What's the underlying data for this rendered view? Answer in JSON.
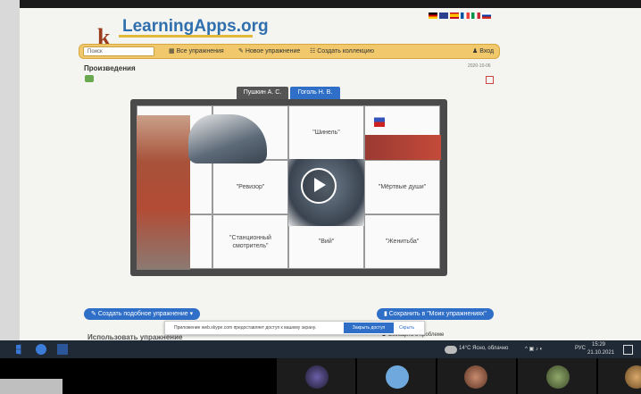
{
  "app": {
    "logo_letter": "k",
    "logo_text": "LearningApps.org"
  },
  "header": {
    "search_placeholder": "Поиск",
    "login_label": "Вход"
  },
  "nav": {
    "all_exercises": "Все упражнения",
    "new_exercise": "Новое упражнение",
    "create_collection": "Создать коллекцию"
  },
  "page": {
    "title": "Произведения",
    "date": "2020-10-06"
  },
  "tabs": [
    {
      "label": "Пушкин А. С."
    },
    {
      "label": "Гоголь Н. В."
    }
  ],
  "cells": [
    {
      "label": ""
    },
    {
      "label": ""
    },
    {
      "label": "\"Шинель\""
    },
    {
      "label": ""
    },
    {
      "label": ""
    },
    {
      "label": "\"Ревизор\""
    },
    {
      "label": ""
    },
    {
      "label": "\"Мёртвые души\""
    },
    {
      "label": ""
    },
    {
      "label": "\"Станционный смотритель\""
    },
    {
      "label": "\"Вий\""
    },
    {
      "label": "\"Женитьба\""
    }
  ],
  "footer": {
    "create_similar": "Создать подобное упражнение",
    "save_to_mine": "Сохранить в \"Моих упражнениях\"",
    "use_exercise": "Использовать упражнение",
    "report_problem": "Сообщить о проблеме"
  },
  "skype": {
    "message": "Приложение web.skype.com предоставляет доступ к вашему экрану.",
    "stop": "Закрыть доступ",
    "hide": "Скрыть"
  },
  "taskbar": {
    "weather": "14°C  Ясно, облачно",
    "lang": "РУС",
    "time": "15:29",
    "date": "21.10.2021"
  },
  "colors": {
    "accent": "#2f6fc7",
    "nav_bar": "#f1c86b",
    "dark_tab": "#555555"
  }
}
